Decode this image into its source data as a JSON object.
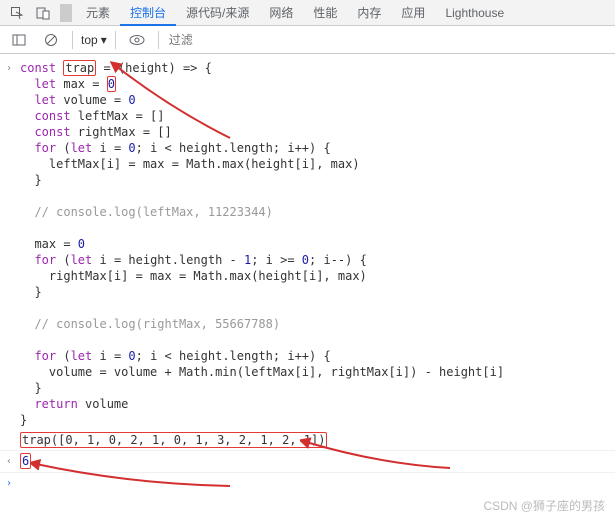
{
  "tabs": {
    "elements": "元素",
    "console": "控制台",
    "sources": "源代码/来源",
    "network": "网络",
    "performance": "性能",
    "memory": "内存",
    "application": "应用",
    "lighthouse": "Lighthouse"
  },
  "toolbar": {
    "context": "top",
    "filter_placeholder": "过滤"
  },
  "code": {
    "l1a": "const ",
    "l1_trap": "trap",
    "l1b": " = (height) => {",
    "l2": "  let max = 0",
    "l2a": "  let max = ",
    "l3": "  let volume = 0",
    "l4": "  const leftMax = []",
    "l5": "  const rightMax = []",
    "l6": "  for (let i = 0; i < height.length; i++) {",
    "l7": "    leftMax[i] = max = Math.max(height[i], max)",
    "l8": "  }",
    "l9": "",
    "l10": "  // console.log(leftMax, 11223344)",
    "l11": "",
    "l12": "  max = 0",
    "l13": "  for (let i = height.length - 1; i >= 0; i--) {",
    "l14": "    rightMax[i] = max = Math.max(height[i], max)",
    "l15": "  }",
    "l16": "",
    "l17": "  // console.log(rightMax, 55667788)",
    "l18": "",
    "l19": "  for (let i = 0; i < height.length; i++) {",
    "l20": "    volume = volume + Math.min(leftMax[i], rightMax[i]) - height[i]",
    "l21": "  }",
    "l22": "  return volume",
    "l23": "}"
  },
  "call": "trap([0, 1, 0, 2, 1, 0, 1, 3, 2, 1, 2, 1])",
  "result": "6",
  "watermark": "CSDN @狮子座的男孩"
}
